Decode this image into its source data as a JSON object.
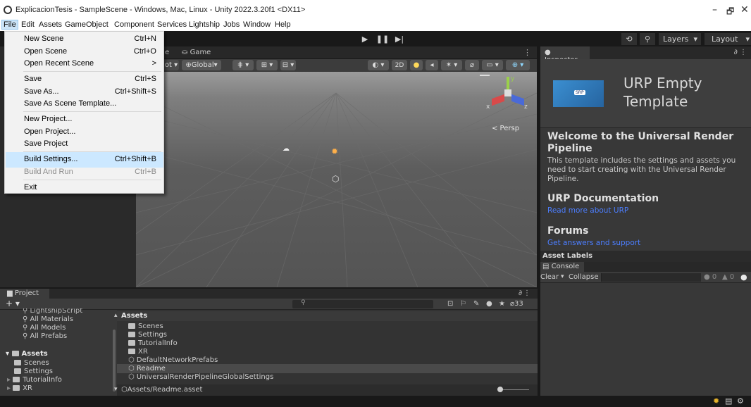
{
  "window": {
    "title": "ExplicacionTesis - SampleScene - Windows, Mac, Linux - Unity 2022.3.20f1 <DX11>",
    "minimize": "–",
    "maximize": "🗗",
    "close": "✕"
  },
  "menubar": [
    "File",
    "Edit",
    "Assets",
    "GameObject",
    "Component",
    "Services",
    "Lightship",
    "Jobs",
    "Window",
    "Help"
  ],
  "file_menu": [
    {
      "label": "New Scene",
      "shortcut": "Ctrl+N"
    },
    {
      "label": "Open Scene",
      "shortcut": "Ctrl+O"
    },
    {
      "label": "Open Recent Scene",
      "shortcut": ">"
    },
    {
      "label": "Save",
      "shortcut": "Ctrl+S"
    },
    {
      "label": "Save As...",
      "shortcut": "Ctrl+Shift+S"
    },
    {
      "label": "Save As Scene Template...",
      "shortcut": ""
    },
    {
      "label": "New Project...",
      "shortcut": ""
    },
    {
      "label": "Open Project...",
      "shortcut": ""
    },
    {
      "label": "Save Project",
      "shortcut": ""
    },
    {
      "label": "Build Settings...",
      "shortcut": "Ctrl+Shift+B"
    },
    {
      "label": "Build And Run",
      "shortcut": "Ctrl+B"
    },
    {
      "label": "Exit",
      "shortcut": ""
    }
  ],
  "toolbar": {
    "layers": "Layers",
    "layout": "Layout"
  },
  "scene": {
    "tab_scene_fragment": "e",
    "tab_game": "Game",
    "tool_pivot_fragment": "ot ▾",
    "tool_global": "Global",
    "mode_2d": "2D",
    "persp": "< Persp",
    "gizmo_y": "y",
    "gizmo_x": "x",
    "gizmo_z": "z"
  },
  "inspector": {
    "tab": "Inspector",
    "thumb": "SRP",
    "title_line1": "URP Empty",
    "title_line2": "Template",
    "welcome_line1": "Welcome to the Universal Render",
    "welcome_line2": "Pipeline",
    "welcome_body_line1": "This template includes the settings and assets you",
    "welcome_body_line2": "need to start creating with the Universal Render",
    "welcome_body_line3": "Pipeline.",
    "doc_heading": "URP Documentation",
    "doc_link": "Read more about URP",
    "forums_heading": "Forums",
    "forums_link": "Get answers and support"
  },
  "asset_labels": "Asset Labels",
  "console": {
    "tab": "Console",
    "clear": "Clear",
    "collapse": "Collapse",
    "info_count": "0",
    "warn_count": "0"
  },
  "project": {
    "tab": "Project",
    "add": "+ ▾",
    "hidden_count": "33",
    "search_items": [
      "LightshipScript",
      "All Materials",
      "All Models",
      "All Prefabs"
    ],
    "tree_root": "Assets",
    "tree_items": [
      "Scenes",
      "Settings",
      "TutorialInfo",
      "XR"
    ],
    "assets_header": "Assets",
    "assets_list": [
      "Scenes",
      "Settings",
      "TutorialInfo",
      "XR",
      "DefaultNetworkPrefabs",
      "Readme",
      "UniversalRenderPipelineGlobalSettings"
    ],
    "selected_path": "Assets/Readme.asset"
  },
  "colors": {
    "accent": "#cce8ff",
    "link": "#4c7eff",
    "panel": "#383838"
  }
}
